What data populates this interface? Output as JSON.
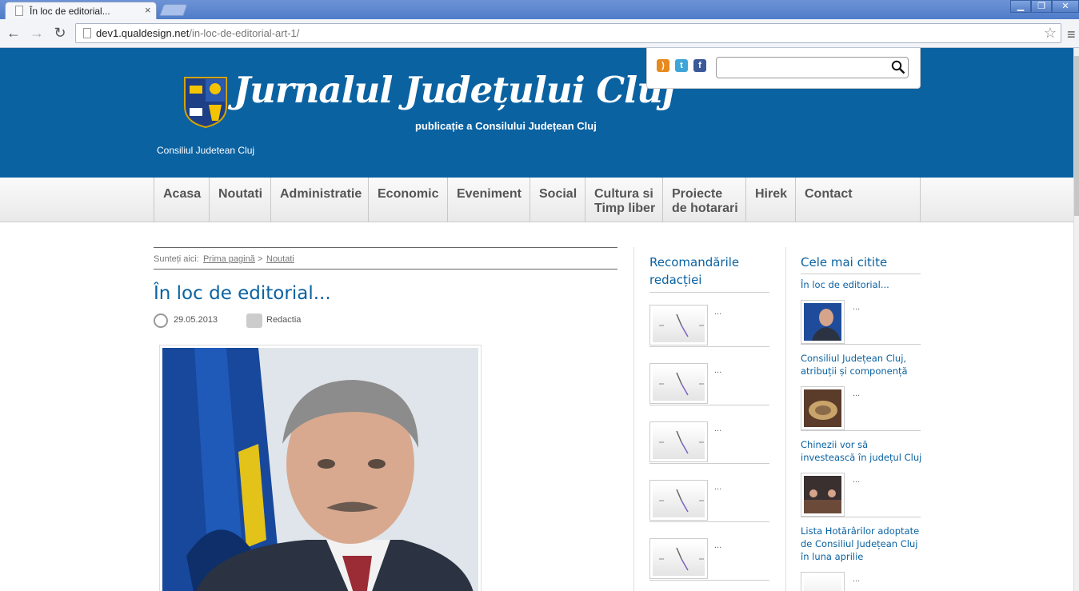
{
  "browser": {
    "tab_title": "În loc de editorial...",
    "tab_close": "×",
    "url_host": "dev1.qualdesign.net",
    "url_path": "/in-loc-de-editorial-art-1/",
    "back": "←",
    "forward": "→",
    "reload": "↻",
    "star": "☆",
    "menu": "≡",
    "minimize": "▁",
    "restore": "❐",
    "close": "✕"
  },
  "header": {
    "site_title": "Jurnalul Județului Cluj",
    "site_subtitle": "publicație a Consilului Județean Cluj",
    "council_label": "Consiliul Judetean Cluj",
    "search_placeholder": ""
  },
  "nav": {
    "items": [
      {
        "label": "Acasa"
      },
      {
        "label": "Noutati"
      },
      {
        "label": "Administratie"
      },
      {
        "label": "Economic"
      },
      {
        "label": "Eveniment"
      },
      {
        "label": "Social"
      },
      {
        "label": "Cultura si",
        "label2": "Timp liber"
      },
      {
        "label": "Proiecte",
        "label2": "de hotarari"
      },
      {
        "label": "Hirek"
      },
      {
        "label": "Contact"
      }
    ]
  },
  "breadcrumb": {
    "prefix": "Sunteți aici:",
    "home": "Prima pagină",
    "separator": ">",
    "section": "Noutati"
  },
  "article": {
    "title": "În loc de editorial...",
    "date": "29.05.2013",
    "author": "Redactia"
  },
  "recommendations": {
    "title_line1": "Recomandările",
    "title_line2": "redacției",
    "items": [
      {
        "text": "..."
      },
      {
        "text": "..."
      },
      {
        "text": "..."
      },
      {
        "text": "..."
      },
      {
        "text": "..."
      }
    ]
  },
  "most_read": {
    "title": "Cele mai citite",
    "items": [
      {
        "title": "În loc de editorial...",
        "text": "..."
      },
      {
        "title": "Consiliul Județean Cluj, atribuții și componență",
        "text": "..."
      },
      {
        "title": "Chinezii vor să investească în județul Cluj",
        "text": "..."
      },
      {
        "title": "Lista Hotărârilor adoptate de Consiliul Județean Cluj în luna aprilie",
        "text": "..."
      }
    ]
  },
  "colors": {
    "brand_blue": "#0a62a1",
    "nav_text": "#555555"
  }
}
